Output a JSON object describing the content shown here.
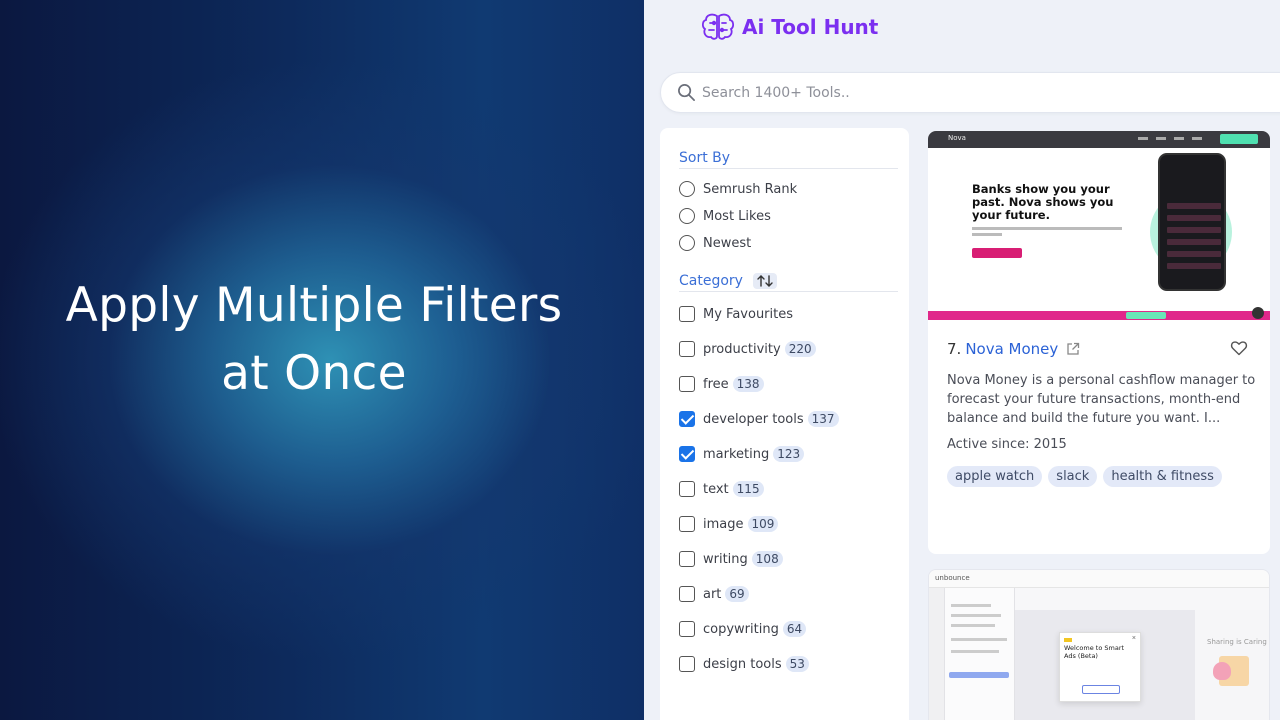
{
  "promo": {
    "title_line1": "Apply Multiple Filters",
    "title_line2": "at Once"
  },
  "app": {
    "logo_text": "Ai Tool Hunt",
    "logo_icon": "brain-icon",
    "search": {
      "placeholder": "Search 1400+ Tools..",
      "icon": "search-icon"
    }
  },
  "filters": {
    "sort_by": {
      "label": "Sort By",
      "options": [
        {
          "label": "Semrush Rank",
          "selected": false
        },
        {
          "label": "Most Likes",
          "selected": false
        },
        {
          "label": "Newest",
          "selected": false
        }
      ]
    },
    "category": {
      "label": "Category",
      "sort_toggle_icon": "sort-arrows-icon",
      "items": [
        {
          "label": "My Favourites",
          "count": "",
          "checked": false
        },
        {
          "label": "productivity",
          "count": "220",
          "checked": false
        },
        {
          "label": "free",
          "count": "138",
          "checked": false
        },
        {
          "label": "developer tools",
          "count": "137",
          "checked": true
        },
        {
          "label": "marketing",
          "count": "123",
          "checked": true
        },
        {
          "label": "text",
          "count": "115",
          "checked": false
        },
        {
          "label": "image",
          "count": "109",
          "checked": false
        },
        {
          "label": "writing",
          "count": "108",
          "checked": false
        },
        {
          "label": "art",
          "count": "69",
          "checked": false
        },
        {
          "label": "copywriting",
          "count": "64",
          "checked": false
        },
        {
          "label": "design tools",
          "count": "53",
          "checked": false
        }
      ]
    }
  },
  "tool_card": {
    "rank": "7.",
    "name": "Nova Money",
    "description": "Nova Money is a personal cashflow manager to forecast your future transactions, month-end balance and build the future you want. I...",
    "active_since": "Active since: 2015",
    "tags": [
      "apple watch",
      "slack",
      "health & fitness"
    ],
    "screenshot": {
      "brand": "Nova",
      "headline": "Banks show you your past. Nova shows you your future."
    },
    "icons": {
      "external": "external-link-icon",
      "favorite": "heart-icon"
    }
  },
  "tool_card_2": {
    "screenshot": {
      "brand": "unbounce",
      "modal_title": "Welcome to Smart Ads (Beta)",
      "side_text": "Sharing is Caring"
    }
  },
  "colors": {
    "accent": "#7b2ff0",
    "link": "#2b62d6",
    "checkbox": "#1a73e8",
    "section_label": "#3b6fd6"
  }
}
